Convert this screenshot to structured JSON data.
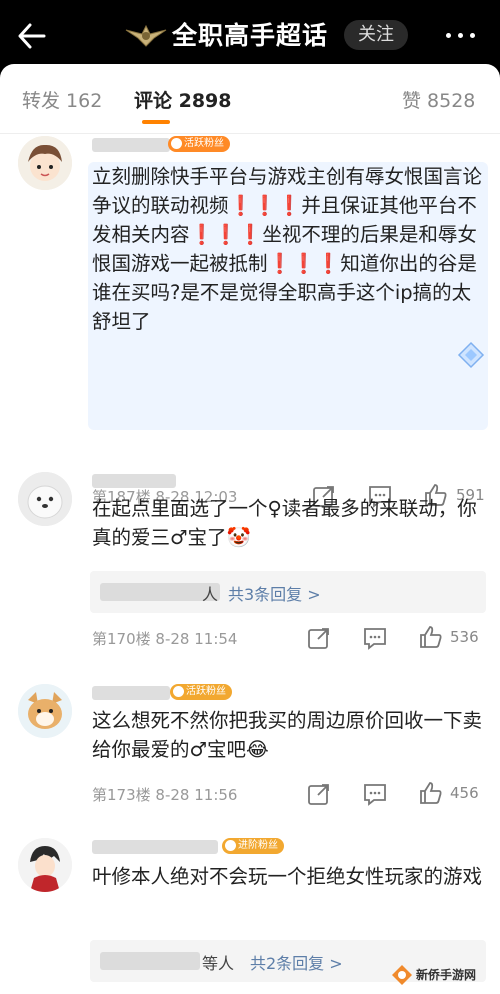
{
  "header": {
    "back_icon": "arrow-left-icon",
    "title": "全职高手超话",
    "follow_label": "关注",
    "more_icon": "more-icon"
  },
  "tabs": [
    {
      "label": "转发 162",
      "active": false
    },
    {
      "label": "评论 2898",
      "active": true
    },
    {
      "label": "赞 8528",
      "active": false
    }
  ],
  "accent_color": "#ff8200",
  "comments": [
    {
      "badge": "活跃粉丝",
      "text": "立刻删除快手平台与游戏主创有辱女恨国言论争议的联动视频❗❗❗并且保证其他平台不发相关内容❗❗❗坐视不理的后果是和辱女恨国游戏一起被抵制❗❗❗知道你出的谷是谁在买吗?是不是觉得全职高手这个ip搞的太舒坦了",
      "floor": "第187楼",
      "time": "8-28 12:03",
      "likes": "591"
    },
    {
      "badge": "",
      "text": "在起点里面选了一个♀读者最多的来联动，你真的爱三♂宝了🤡",
      "replies_people": "人",
      "replies_link": "共3条回复 >",
      "floor": "第170楼",
      "time": "8-28 11:54",
      "likes": "536"
    },
    {
      "badge": "活跃粉丝",
      "text": "这么想死不然你把我买的周边原价回收一下卖给你最爱的♂宝吧😂",
      "floor": "第173楼",
      "time": "8-28 11:56",
      "likes": "456"
    },
    {
      "badge": "进阶粉丝",
      "text": "叶修本人绝对不会玩一个拒绝女性玩家的游戏",
      "replies_people": "等人",
      "replies_link": "共2条回复 >"
    }
  ],
  "watermark": "新侨手游网"
}
